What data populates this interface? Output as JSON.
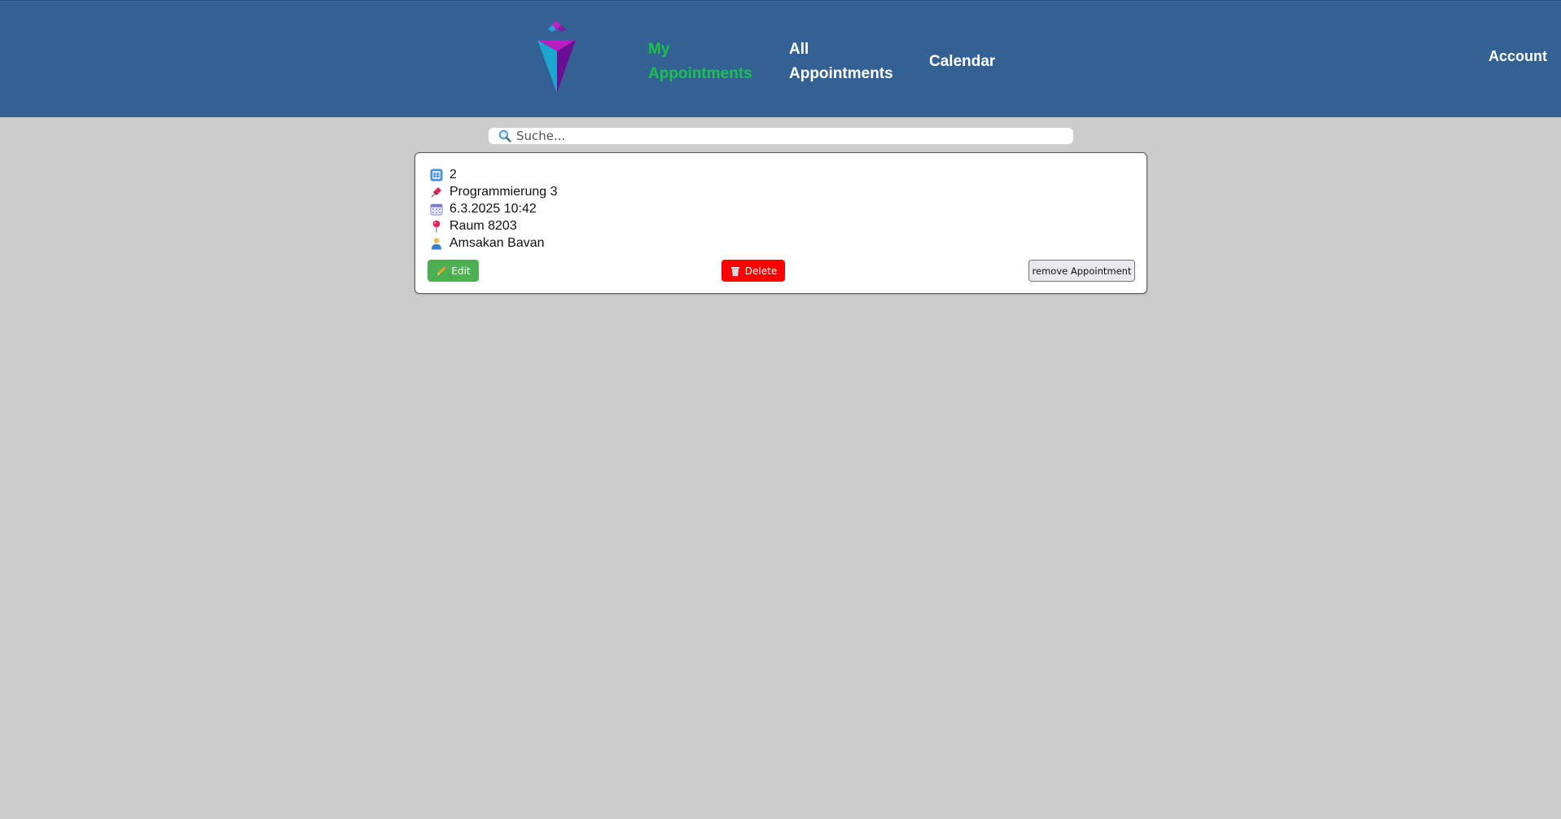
{
  "nav": {
    "my_appointments": "My\nAppointments",
    "all_appointments": "All\nAppointments",
    "calendar": "Calendar",
    "account": "Account"
  },
  "search": {
    "placeholder": "Suche..."
  },
  "appointment": {
    "id": "2",
    "title": "Programmierung 3",
    "datetime": "6.3.2025 10:42",
    "room": "Raum 8203",
    "person": "Amsakan Bavan",
    "edit_label": "Edit",
    "delete_label": "Delete",
    "remove_label": "remove Appointment"
  },
  "colors": {
    "header": "#346194",
    "active_nav": "#19c24a",
    "edit": "#4caf50",
    "delete": "#ff0000",
    "background": "#cccccc"
  },
  "icons": {
    "id": "hash-keycap-icon",
    "title": "pushpin-icon",
    "date": "calendar-icon",
    "room": "round-pin-icon",
    "person": "person-icon",
    "edit": "pencil-icon",
    "delete": "wastebasket-icon",
    "search": "magnifier-icon"
  }
}
